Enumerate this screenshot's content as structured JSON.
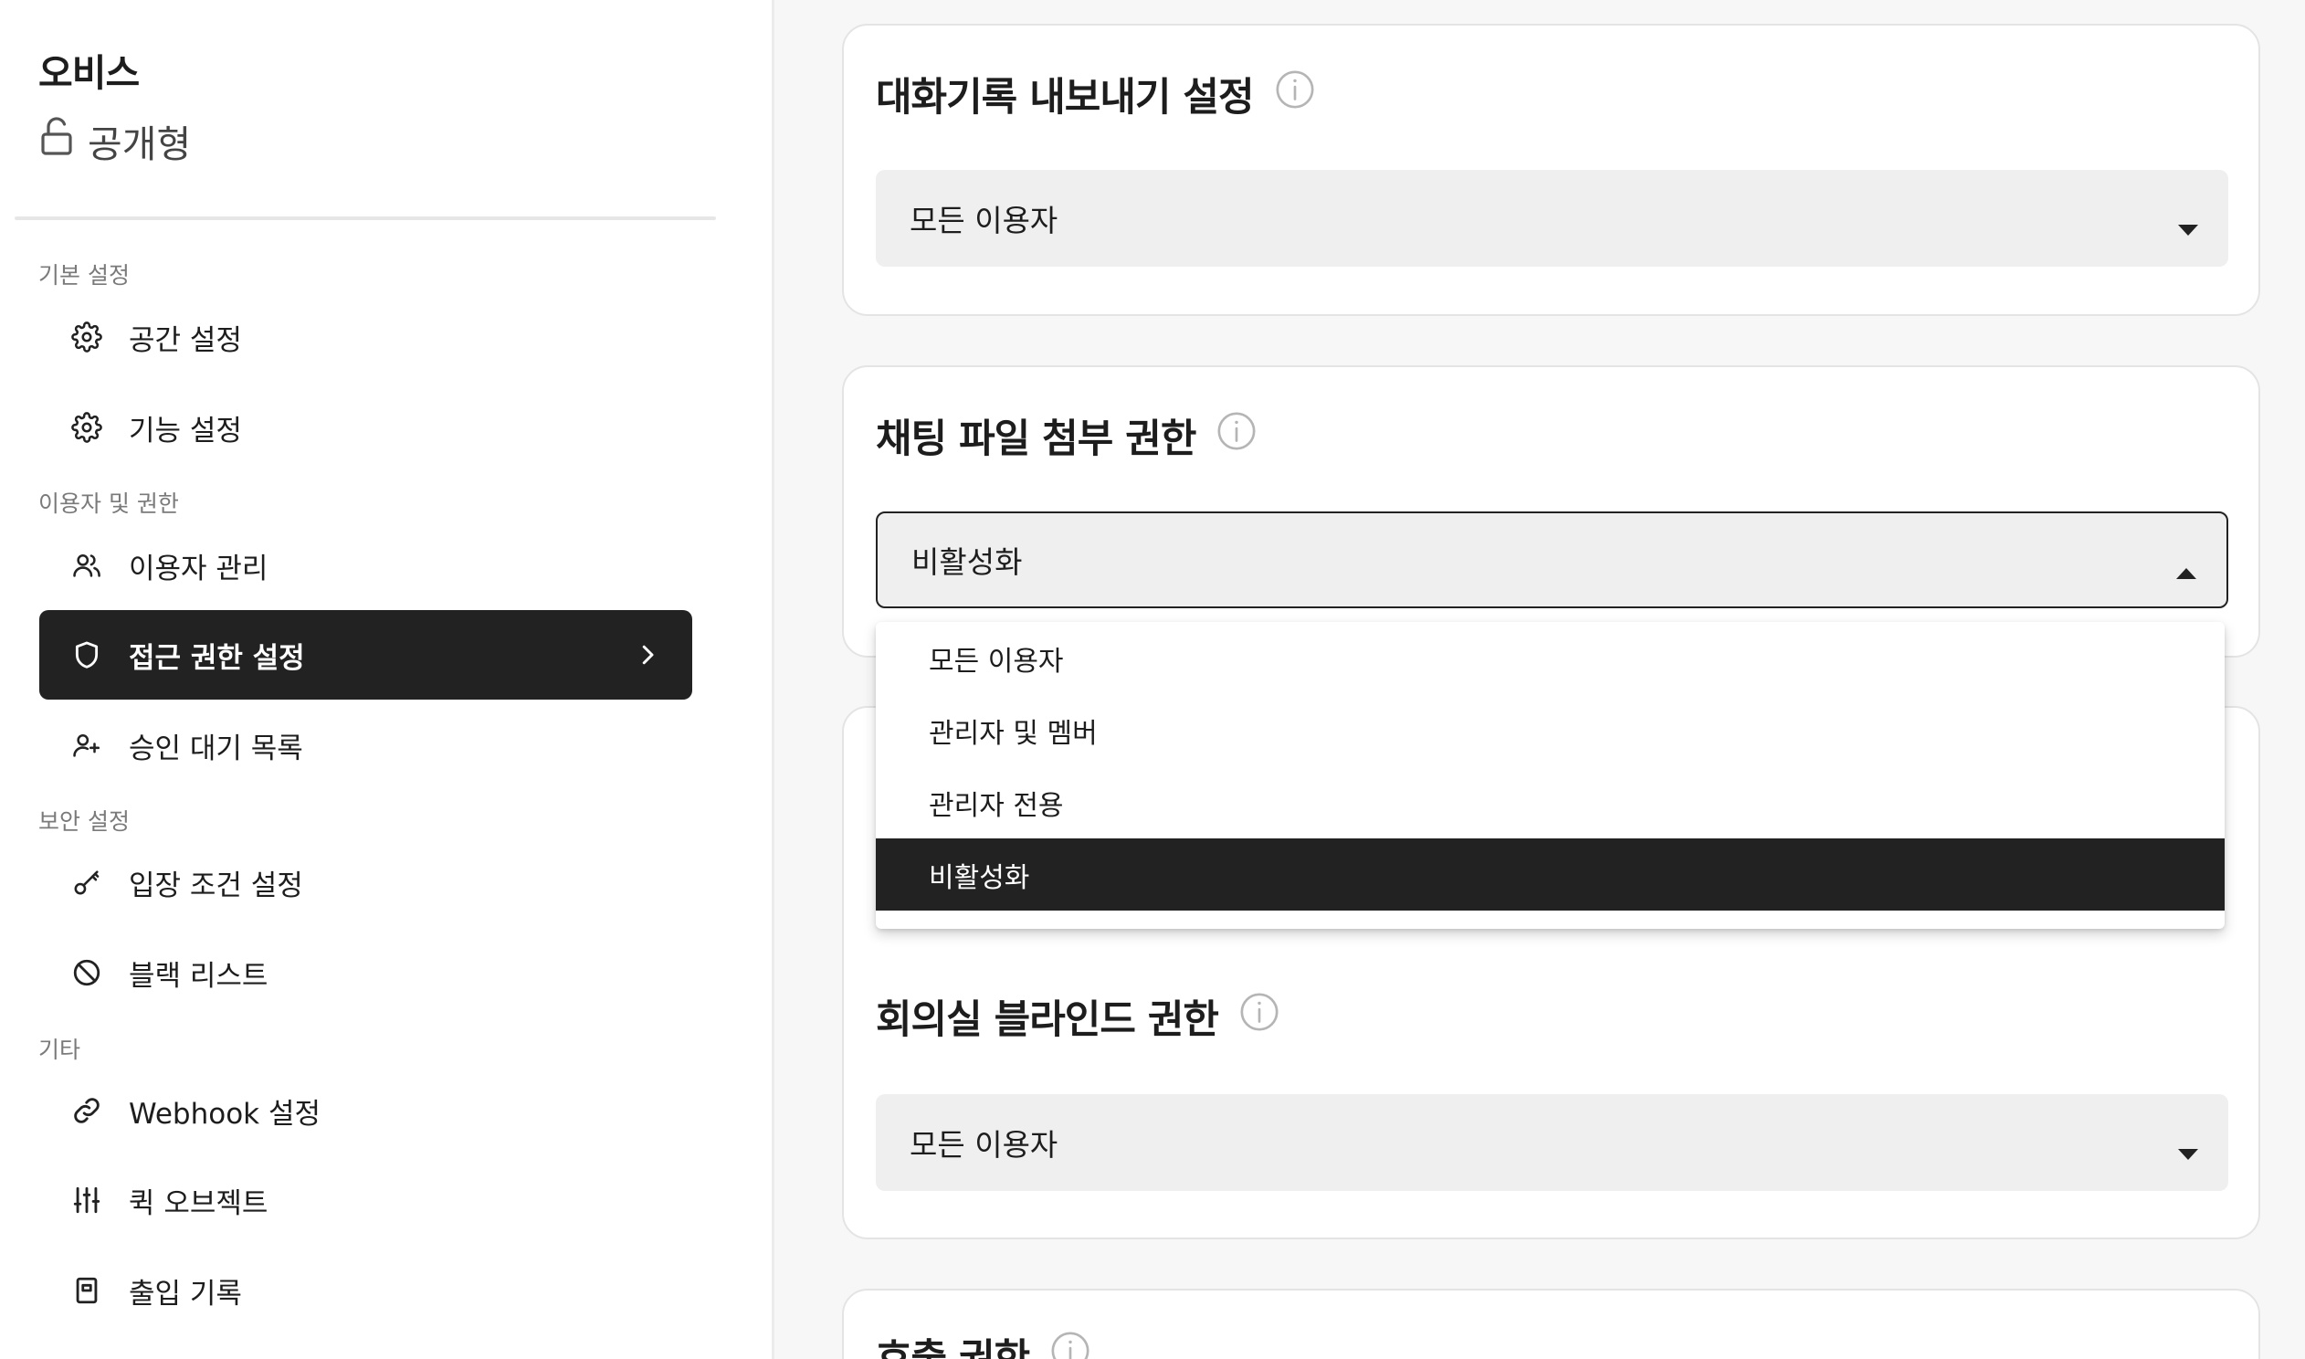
{
  "space": {
    "name": "오비스",
    "type_label": "공개형",
    "type_icon": "unlock-icon"
  },
  "sidebar": {
    "sections": [
      {
        "label": "기본 설정"
      },
      {
        "label": "이용자 및 권한"
      },
      {
        "label": "보안 설정"
      },
      {
        "label": "기타"
      }
    ],
    "items": [
      {
        "label": "공간 설정",
        "icon": "gear-icon"
      },
      {
        "label": "기능 설정",
        "icon": "gear-icon"
      },
      {
        "label": "이용자 관리",
        "icon": "users-icon"
      },
      {
        "label": "접근 권한 설정",
        "icon": "shield-icon",
        "active": true
      },
      {
        "label": "승인 대기 목록",
        "icon": "user-plus-icon"
      },
      {
        "label": "입장 조건 설정",
        "icon": "key-icon"
      },
      {
        "label": "블랙 리스트",
        "icon": "ban-icon"
      },
      {
        "label": "Webhook 설정",
        "icon": "link-icon"
      },
      {
        "label": "퀵 오브젝트",
        "icon": "sliders-icon"
      },
      {
        "label": "출입 기록",
        "icon": "log-icon"
      }
    ]
  },
  "cards": [
    {
      "title": "대화기록 내보내기 설정",
      "value": "모든 이용자"
    },
    {
      "title": "채팅 파일 첨부 권한",
      "value": "비활성화",
      "open": true
    },
    {
      "title": "회의실 블라인드 권한",
      "value": "모든 이용자"
    },
    {
      "title": "호출 권한"
    }
  ],
  "dropdown": {
    "options": [
      "모든 이용자",
      "관리자 및 멤버",
      "관리자 전용",
      "비활성화"
    ],
    "selected": "비활성화"
  },
  "colors": {
    "active_bg": "#222222",
    "select_bg": "#efefef",
    "page_bg": "#f7f7f7"
  }
}
